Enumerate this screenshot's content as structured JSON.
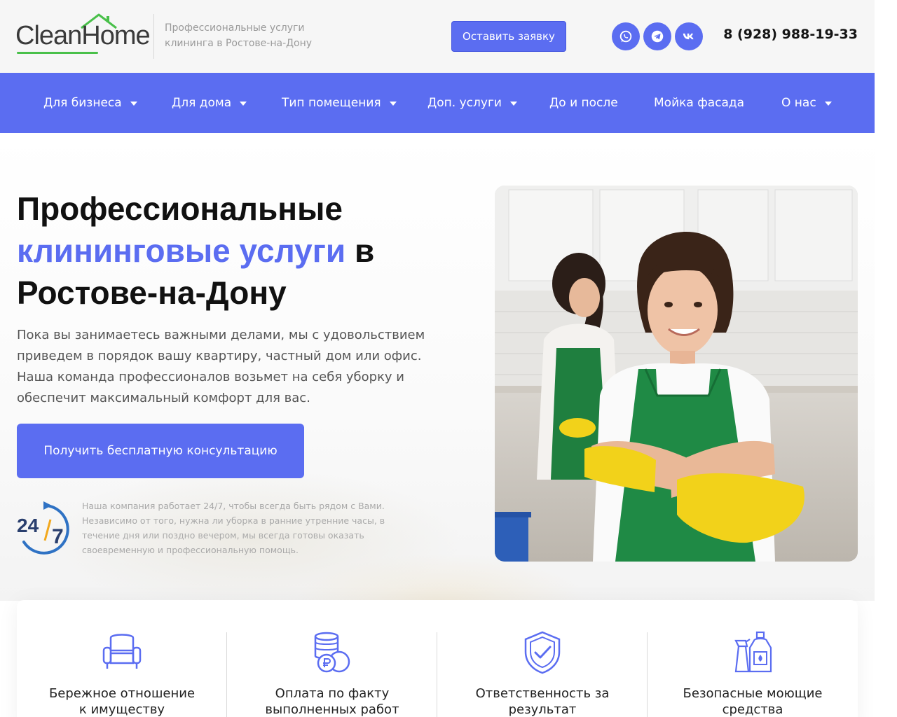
{
  "header": {
    "logo": "CleanHome",
    "tagline_line1": "Профессиональные услуги",
    "tagline_line2": "клининга в Ростове-на-Дону",
    "cta_label": "Оставить заявку",
    "social": [
      {
        "name": "whatsapp-icon"
      },
      {
        "name": "telegram-icon"
      },
      {
        "name": "vk-icon"
      }
    ],
    "phone": "8 (928) 988-19-33"
  },
  "nav": {
    "items": [
      {
        "label": "Для бизнеса",
        "dropdown": true
      },
      {
        "label": "Для дома",
        "dropdown": true
      },
      {
        "label": "Тип помещения",
        "dropdown": true
      },
      {
        "label": "Доп. услуги",
        "dropdown": true
      },
      {
        "label": "До и после",
        "dropdown": false
      },
      {
        "label": "Мойка фасада",
        "dropdown": false
      },
      {
        "label": "О нас",
        "dropdown": true
      }
    ]
  },
  "hero": {
    "title_line1": "Профессиональные",
    "title_accent": "клининговые услуги",
    "title_line2_rest": " в",
    "title_line3": "Ростове-на-Дону",
    "lead_lines": [
      "Пока вы занимаетесь важными делами, мы с удовольствием",
      "приведем в порядок вашу квартиру, частный дом или офис.",
      "Наша команда профессионалов возьмет на себя уборку и",
      "обеспечит максимальный комфорт для вас."
    ],
    "cta_label": "Получить бесплатную консультацию",
    "badge_text": "24/7",
    "note_lines": [
      "Наша компания работает 24/7, чтобы всегда быть рядом с Вами.",
      "Независимо от того, нужна ли уборка в ранние утренние часы, в",
      "течение дня или поздно вечером, мы всегда готовы оказать",
      "своевременную и профессиональную помощь."
    ]
  },
  "features": [
    {
      "icon": "armchair-icon",
      "line1": "Бережное отношение",
      "line2": "к имуществу"
    },
    {
      "icon": "coins-ruble-icon",
      "line1": "Оплата по факту",
      "line2": "выполненных работ"
    },
    {
      "icon": "shield-check-icon",
      "line1": "Ответственность за",
      "line2": "результат"
    },
    {
      "icon": "detergent-bottles-icon",
      "line1": "Безопасные моющие",
      "line2": "средства"
    }
  ],
  "colors": {
    "accent": "#5b6df1",
    "logo_green": "#49c04a",
    "apron_green": "#1f8a45",
    "glove_yellow": "#f2d21a"
  }
}
